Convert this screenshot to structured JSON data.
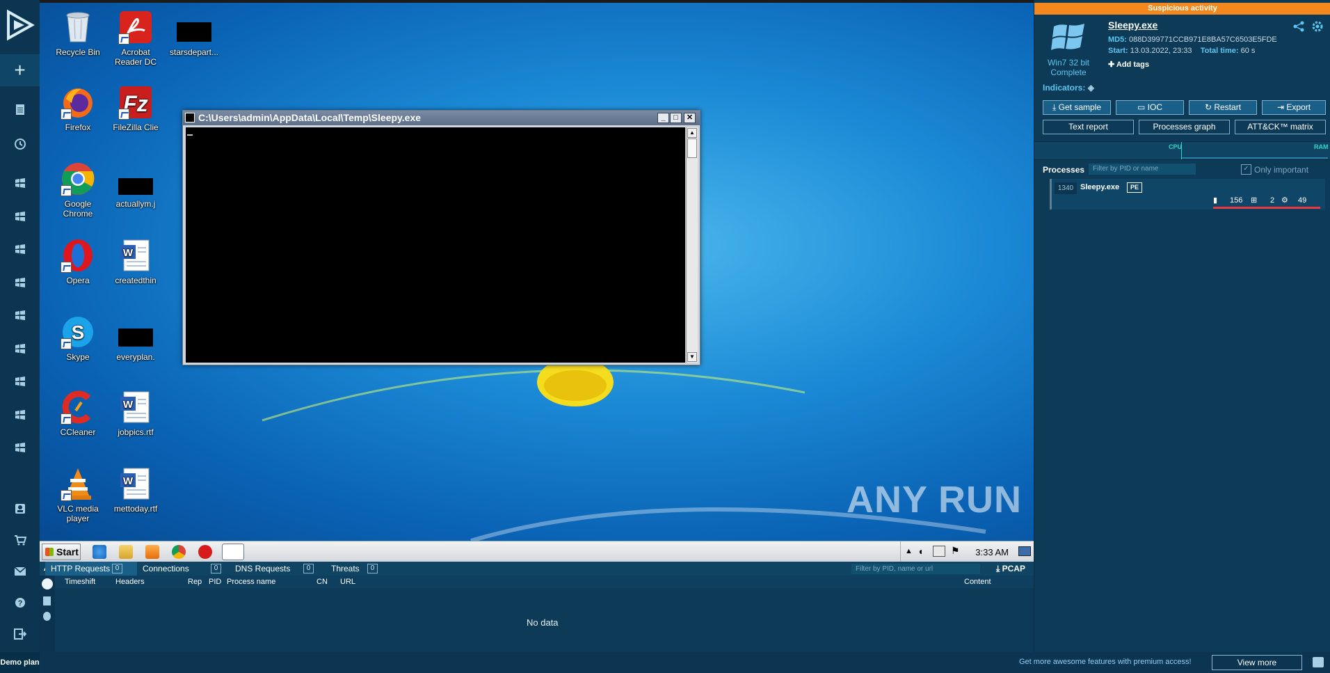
{
  "sidebar": {
    "items": [
      "new-task",
      "reports",
      "history",
      "task-1",
      "task-2",
      "task-3",
      "task-4",
      "task-5",
      "task-6",
      "task-7",
      "task-8",
      "task-9",
      "profile",
      "cart",
      "mail",
      "help",
      "logout"
    ],
    "demo_label": "Demo plan"
  },
  "desktop": {
    "icons": [
      {
        "label": "Recycle Bin",
        "icon": "recycle-bin-icon"
      },
      {
        "label": "Acrobat\nReader DC",
        "icon": "acrobat-icon"
      },
      {
        "label": "starsdepart...",
        "icon": "redacted-file-icon"
      },
      {
        "label": "Firefox",
        "icon": "firefox-icon"
      },
      {
        "label": "FileZilla Clie",
        "icon": "filezilla-icon"
      },
      {
        "label": "Google\nChrome",
        "icon": "chrome-icon"
      },
      {
        "label": "actuallym.j",
        "icon": "redacted-file-icon"
      },
      {
        "label": "Opera",
        "icon": "opera-icon"
      },
      {
        "label": "createdthin",
        "icon": "word-doc-icon"
      },
      {
        "label": "Skype",
        "icon": "skype-icon"
      },
      {
        "label": "everyplan.",
        "icon": "redacted-file-icon"
      },
      {
        "label": "CCleaner",
        "icon": "ccleaner-icon"
      },
      {
        "label": "jobpics.rtf",
        "icon": "word-doc-icon"
      },
      {
        "label": "VLC media\nplayer",
        "icon": "vlc-icon"
      },
      {
        "label": "mettoday.rtf",
        "icon": "word-doc-icon"
      }
    ],
    "watermark": "ANY RUN"
  },
  "console": {
    "title": "C:\\Users\\admin\\AppData\\Local\\Temp\\Sleepy.exe"
  },
  "taskbar": {
    "start_label": "Start",
    "clock": "3:33 AM"
  },
  "network": {
    "tabs": [
      {
        "label": "HTTP Requests",
        "count": "0"
      },
      {
        "label": "Connections",
        "count": "0"
      },
      {
        "label": "DNS Requests",
        "count": "0"
      },
      {
        "label": "Threats",
        "count": "0"
      }
    ],
    "filter_placeholder": "Filter by PID, name or url",
    "pcap_label": "PCAP",
    "columns": [
      "Timeshift",
      "Headers",
      "Rep",
      "PID",
      "Process name",
      "CN",
      "URL",
      "Content"
    ],
    "empty_text": "No data"
  },
  "footer": {
    "promo": "Get more awesome features with premium access!",
    "view_more": "View more"
  },
  "report": {
    "banner": "Suspicious activity",
    "os_name": "Win7 32 bit",
    "os_status": "Complete",
    "filename": "Sleepy.exe",
    "md5_label": "MD5:",
    "md5": "088D399771CCB971E8BA57C6503E5FDE",
    "start_label": "Start:",
    "start": "13.03.2022, 23:33",
    "total_label": "Total time:",
    "total": "60 s",
    "add_tags": "Add tags",
    "indicators_label": "Indicators:",
    "buttons": [
      "Get sample",
      "IOC",
      "Restart",
      "Export"
    ],
    "buttons2": [
      "Text report",
      "Processes graph",
      "ATT&CK™ matrix"
    ],
    "cpu_label": "CPU",
    "ram_label": "RAM",
    "processes_label": "Processes",
    "proc_filter_placeholder": "Filter by PID or name",
    "only_important": "Only important",
    "process": {
      "pid": "1340",
      "name": "Sleepy.exe",
      "badge": "PE",
      "files": "156",
      "modules": "2",
      "registry": "49"
    }
  }
}
